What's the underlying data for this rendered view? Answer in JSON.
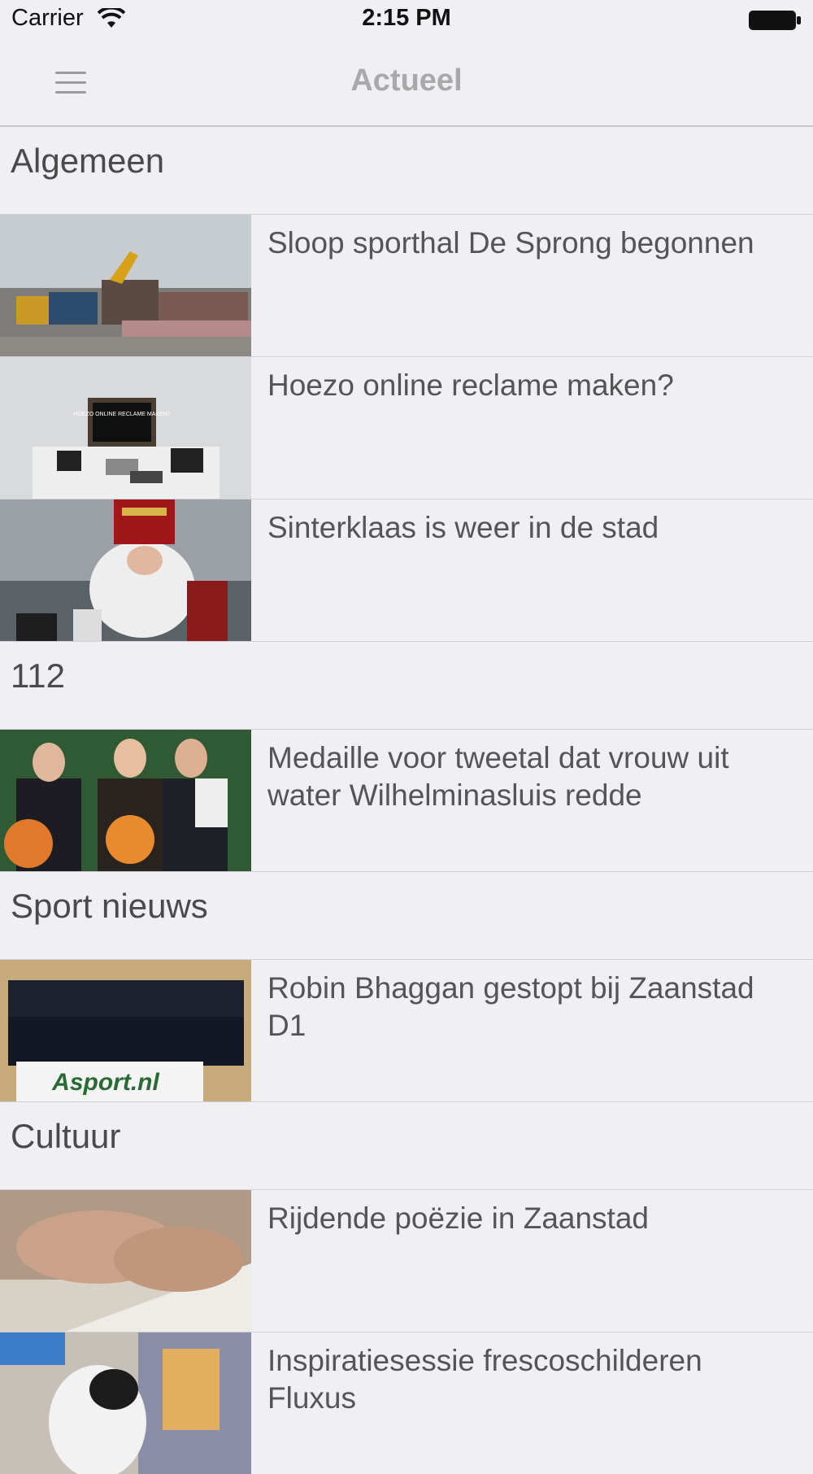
{
  "status_bar": {
    "carrier": "Carrier",
    "time": "2:15 PM"
  },
  "nav": {
    "title": "Actueel",
    "menu_icon": "hamburger-menu-icon"
  },
  "sections": [
    {
      "header": "Algemeen",
      "items": [
        {
          "title": "Sloop sporthal De Sprong begonnen"
        },
        {
          "title": "Hoezo online reclame maken?",
          "thumb_text": "HOEZO ONLINE RECLAME MAKEN?"
        },
        {
          "title": "Sinterklaas is weer in de stad"
        }
      ]
    },
    {
      "header": "112",
      "items": [
        {
          "title": "Medaille voor tweetal dat vrouw uit water Wilhelminasluis redde"
        }
      ]
    },
    {
      "header": "Sport nieuws",
      "items": [
        {
          "title": "Robin Bhaggan gestopt bij Zaanstad D1",
          "thumb_text": "Asport.nl"
        }
      ]
    },
    {
      "header": "Cultuur",
      "items": [
        {
          "title": "Rijdende poëzie in Zaanstad"
        },
        {
          "title": "Inspiratiesessie frescoschilderen Fluxus"
        }
      ]
    }
  ]
}
